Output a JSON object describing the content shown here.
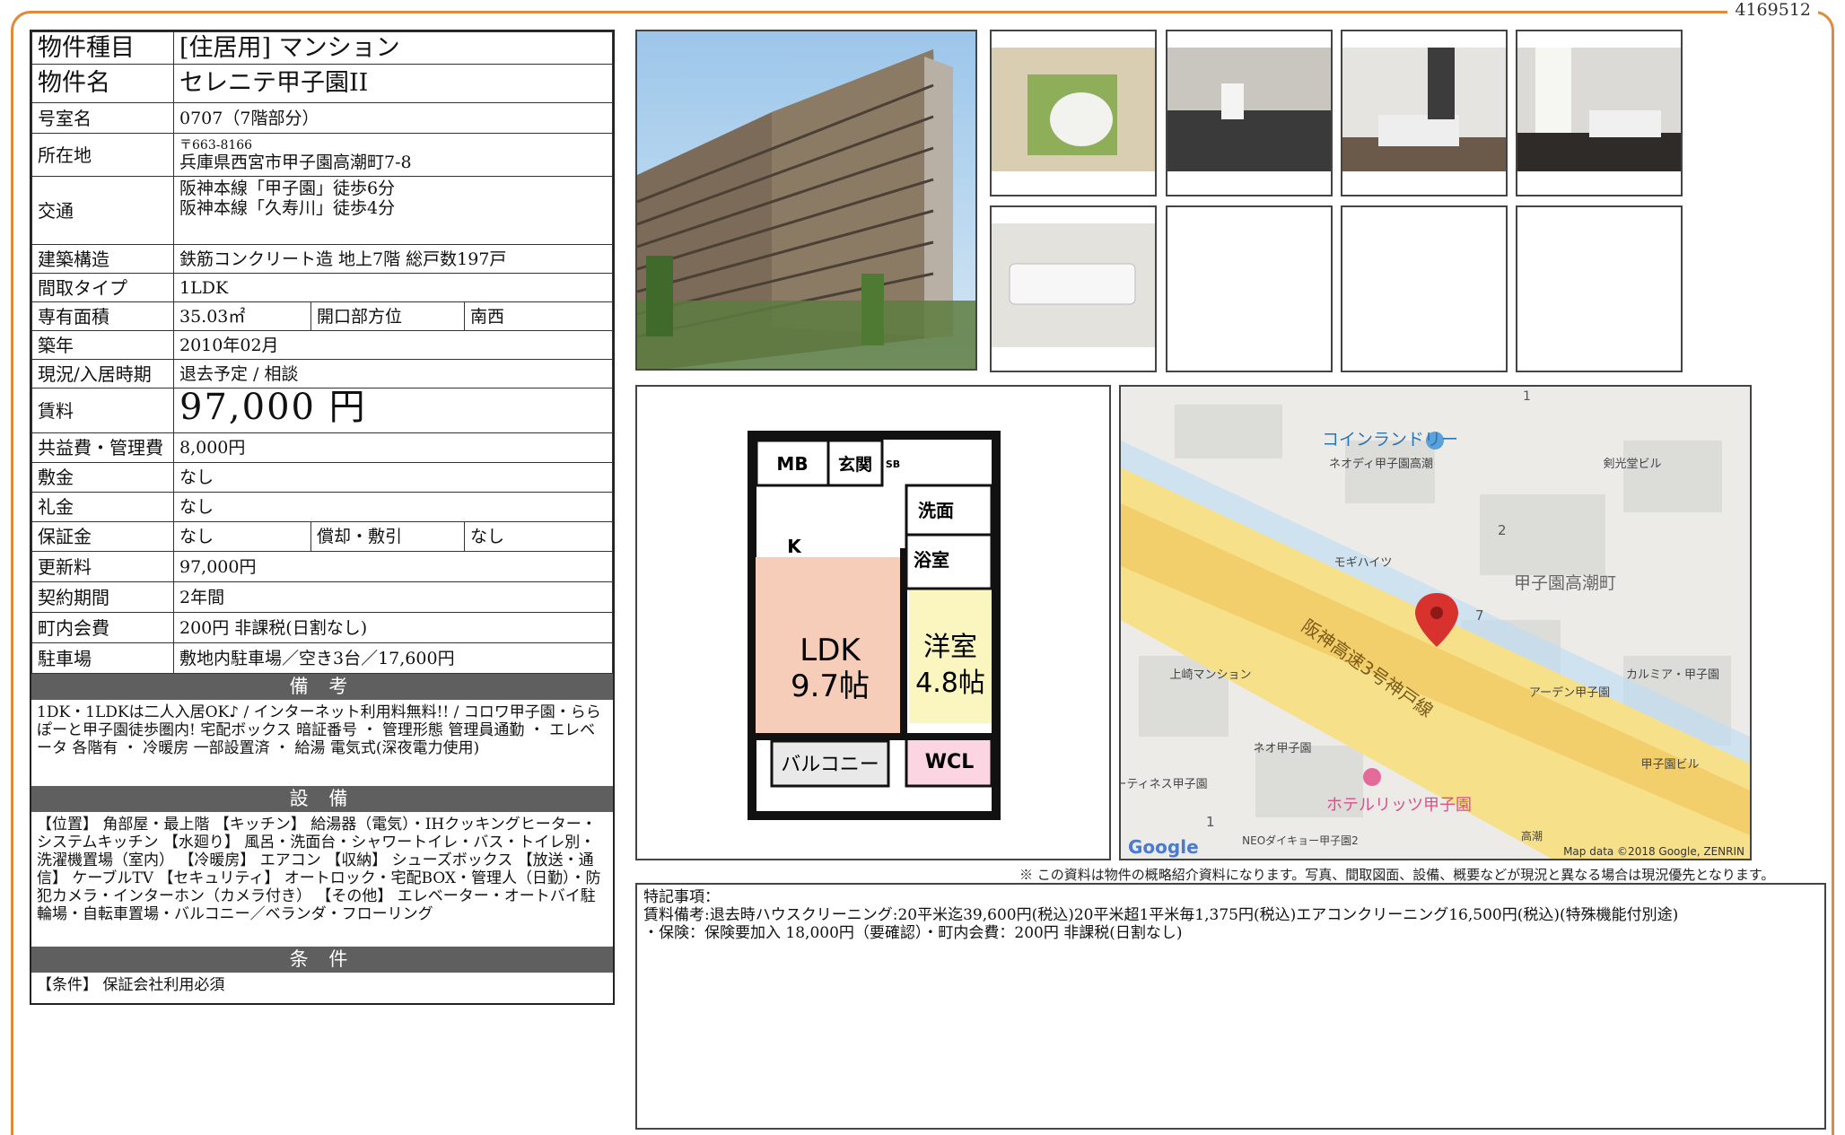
{
  "doc_id": "4169512",
  "spec": {
    "type_label": "物件種目",
    "type_value": "[住居用] マンション",
    "name_label": "物件名",
    "name_value": "セレニテ甲子園II",
    "room_label": "号室名",
    "room_value": "0707（7階部分）",
    "address_label": "所在地",
    "postal": "〒663-8166",
    "address": "兵庫県西宮市甲子園高潮町7-8",
    "transit_label": "交通",
    "transit_1": "阪神本線「甲子園」徒歩6分",
    "transit_2": "阪神本線「久寿川」徒歩4分",
    "structure_label": "建築構造",
    "structure_value": "鉄筋コンクリート造 地上7階 総戸数197戸",
    "layout_label": "間取タイプ",
    "layout_value": "1LDK",
    "area_label": "専有面積",
    "area_value": "35.03㎡",
    "direction_label": "開口部方位",
    "direction_value": "南西",
    "built_label": "築年",
    "built_value": "2010年02月",
    "status_label": "現況/入居時期",
    "status_value": "退去予定 / 相談",
    "rent_label": "賃料",
    "rent_value": "97,000 円",
    "fee_label": "共益費・管理費",
    "fee_value": "8,000円",
    "deposit_label": "敷金",
    "deposit_value": "なし",
    "key_label": "礼金",
    "key_value": "なし",
    "guarantee_label": "保証金",
    "guarantee_value": "なし",
    "amort_label": "償却・敷引",
    "amort_value": "なし",
    "renewal_label": "更新料",
    "renewal_value": "97,000円",
    "contract_label": "契約期間",
    "contract_value": "2年間",
    "town_label": "町内会費",
    "town_value": "200円 非課税(日割なし)",
    "parking_label": "駐車場",
    "parking_value": "敷地内駐車場／空き3台／17,600円"
  },
  "notes": {
    "heading": "備 考",
    "text": "1DK・1LDKは二人入居OK♪ / インターネット利用料無料!! / コロワ甲子園・ららぽーと甲子園徒歩圏内! 宅配ボックス 暗証番号 ・ 管理形態 管理員通勤 ・ エレベータ 各階有 ・ 冷暖房 一部設置済 ・ 給湯 電気式(深夜電力使用)"
  },
  "equipment": {
    "heading": "設 備",
    "text": "【位置】 角部屋・最上階 【キッチン】 給湯器（電気）・IHクッキングヒーター・システムキッチン 【水廻り】 風呂・洗面台・シャワートイレ・バス・トイレ別・洗濯機置場（室内） 【冷暖房】 エアコン 【収納】 シューズボックス 【放送・通信】 ケーブルTV 【セキュリティ】 オートロック・宅配BOX・管理人（日勤）・防犯カメラ・インターホン（カメラ付き） 【その他】 エレベーター・オートバイ駐輪場・自転車置場・バルコニー／ベランダ・フローリング"
  },
  "conditions": {
    "heading": "条 件",
    "text": "【条件】 保証会社利用必須"
  },
  "floorplan": {
    "mb": "MB",
    "genkan": "玄関",
    "sb": "SB",
    "senmen": "洗面",
    "yoku": "浴室",
    "k": "K",
    "ldk": "LDK",
    "ldk_size": "9.7帖",
    "youshitsu": "洋室",
    "youshitsu_size": "4.8帖",
    "balcony": "バルコニー",
    "wcl": "WCL"
  },
  "map": {
    "laundry": "コインランドリー",
    "neo_koshien": "ネオディ甲子園高潮",
    "kenkou": "剣光堂ビル",
    "num1": "1",
    "num2": "2",
    "num7": "7",
    "num1b": "1",
    "mogi": "モギハイツ",
    "town": "甲子園高潮町",
    "highway": "阪神高速3号神戸線",
    "kamisaki": "上崎マンション",
    "karumia": "カルミア・甲子園",
    "arden": "アーデン甲子園",
    "neo": "ネオ甲子園",
    "tinesu": "ーティネス甲子園",
    "koshien_bldg": "甲子園ビル",
    "hotel": "ホテルリッツ甲子園",
    "neodaikyo": "NEOダイキョー甲子園2",
    "takashio": "高潮",
    "google": "Google",
    "attribution": "Map data ©2018 Google, ZENRIN"
  },
  "disclaimer": "※ この資料は物件の概略紹介資料になります。写真、間取図面、設備、概要などが現況と異なる場合は現況優先となります。",
  "remarks": {
    "title": "特記事項：",
    "line1": "賃料備考:退去時ハウスクリーニング:20平米迄39,600円(税込)20平米超1平米毎1,375円(税込)エアコンクリーニング16,500円(税込)(特殊機能付別途)",
    "line2": "・保険：保険要加入 18,000円（要確認）・町内会費：200円 非課税(日割なし)"
  }
}
